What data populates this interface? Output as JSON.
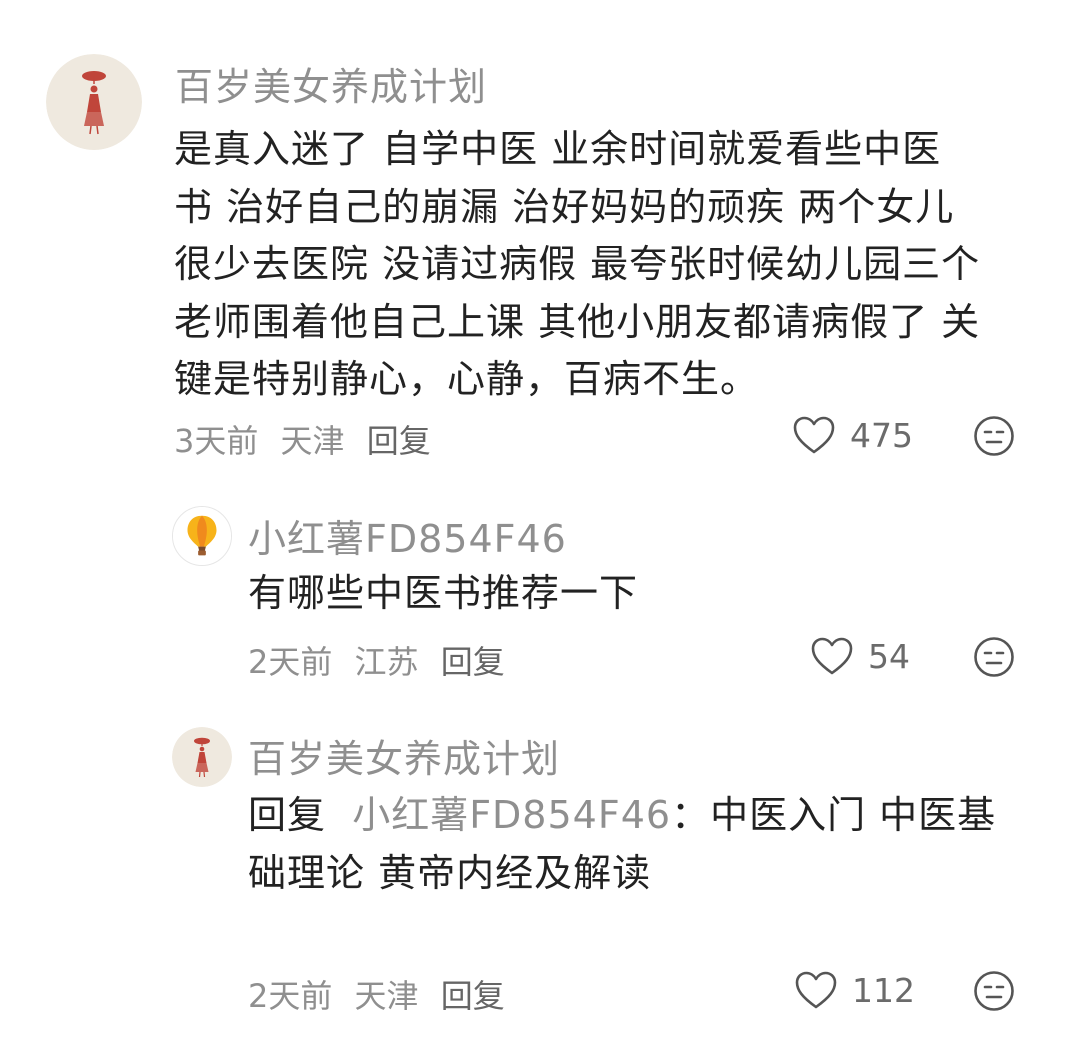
{
  "comments": [
    {
      "author": "百岁美女养成计划",
      "avatar": "red-dancer-avatar",
      "text_lines": [
        "是真入迷了  自学中医 业余时间就爱看些中医",
        "书 治好自己的崩漏 治好妈妈的顽疾 两个女儿",
        "很少去医院 没请过病假 最夸张时候幼儿园三个",
        "老师围着他自己上课 其他小朋友都请病假了 关",
        "键是特别静心，心静，百病不生。"
      ],
      "time": "3天前",
      "location": "天津",
      "reply_label": "回复",
      "likes": "475"
    },
    {
      "author": "小红薯FD854F46",
      "avatar": "hot-air-balloon-avatar",
      "text": "有哪些中医书推荐一下",
      "time": "2天前",
      "location": "江苏",
      "reply_label": "回复",
      "likes": "54"
    },
    {
      "author": "百岁美女养成计划",
      "avatar": "red-dancer-avatar",
      "reply_prefix": "回复",
      "reply_target": "小红薯FD854F46",
      "reply_colon": "：",
      "text_line1": "中医入门 中医基",
      "text_line2": "础理论 黄帝内经及解读",
      "time": "2天前",
      "location": "天津",
      "reply_label": "回复",
      "likes": "112"
    }
  ],
  "colors": {
    "meta_gray": "#8f8f8f",
    "text_dark": "#222222",
    "avatar_bg": "#efe9df",
    "avatar_figure": "#c0453a"
  }
}
